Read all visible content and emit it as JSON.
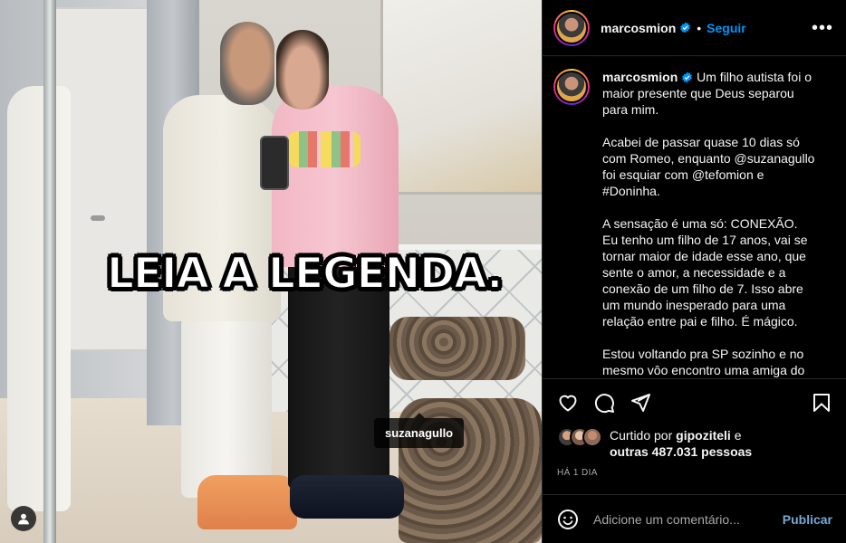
{
  "post": {
    "overlay_text": "LEIA A LEGENDA.",
    "tagged_user": "suzanagullo",
    "user_tag_icon": "person-icon"
  },
  "header": {
    "username": "marcosmion",
    "verified_icon": "verified-badge-icon",
    "separator": "•",
    "follow_label": "Seguir",
    "more_label": "•••"
  },
  "caption": {
    "username": "marcosmion",
    "text": " Um filho autista foi o maior presente que Deus separou para mim.\n\nAcabei de passar quase 10 dias só com Romeo, enquanto @suzanagullo foi esquiar com @tefomion e #Doninha.\n\nA sensação é uma só: CONEXÃO.\nEu tenho um filho de 17 anos, vai se tornar maior de idade esse ano, que sente o amor, a necessidade e a conexão de um filho de 7. Isso abre um mundo inesperado para uma relação entre pai e filho. É mágico.\n\nEstou voltando pra SP sozinho e no mesmo vôo encontro uma amiga do"
  },
  "actions": {
    "like_icon": "heart-icon",
    "comment_icon": "comment-icon",
    "share_icon": "send-icon",
    "save_icon": "bookmark-icon"
  },
  "likes": {
    "prefix": "Curtido por ",
    "user": "gipoziteli",
    "middle": " e",
    "others": "outras 487.031 pessoas"
  },
  "timestamp": "HÁ 1 DIA",
  "comment": {
    "emoji_icon": "emoji-icon",
    "placeholder": "Adicione um comentário...",
    "publish_label": "Publicar"
  },
  "colors": {
    "background": "#000000",
    "follow_blue": "#0095f6",
    "publish_blue": "#76a9d6",
    "divider": "#262626",
    "muted_text": "#a8a8a8"
  }
}
